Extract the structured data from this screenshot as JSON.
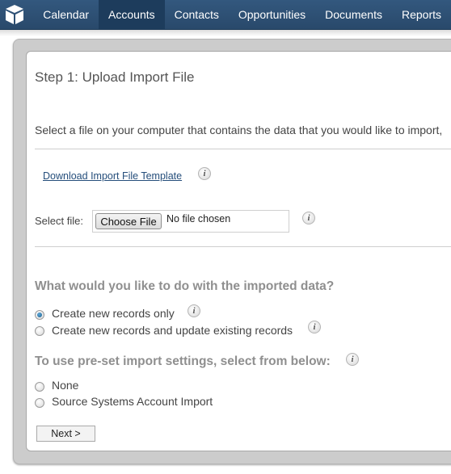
{
  "nav": {
    "logo_icon": "cube-icon",
    "items": [
      {
        "label": "Calendar",
        "active": false
      },
      {
        "label": "Accounts",
        "active": true
      },
      {
        "label": "Contacts",
        "active": false
      },
      {
        "label": "Opportunities",
        "active": false
      },
      {
        "label": "Documents",
        "active": false
      },
      {
        "label": "Reports",
        "active": false
      }
    ]
  },
  "step": {
    "title": "Step 1: Upload Import File",
    "description": "Select a file on your computer that contains the data that you would like to import,",
    "template_link": "Download Import File Template",
    "select_file_label": "Select file:",
    "choose_file_button": "Choose File",
    "file_status": "No file chosen",
    "info_icon": "info-icon"
  },
  "import_action": {
    "heading": "What would you like to do with the imported data?",
    "options": [
      {
        "label": "Create new records only",
        "selected": true
      },
      {
        "label": "Create new records and update existing records",
        "selected": false
      }
    ]
  },
  "preset": {
    "heading": "To use pre-set import settings, select from below:",
    "options": [
      {
        "label": "None",
        "selected": false
      },
      {
        "label": "Source Systems Account Import",
        "selected": false
      }
    ]
  },
  "next_button": "Next >"
}
